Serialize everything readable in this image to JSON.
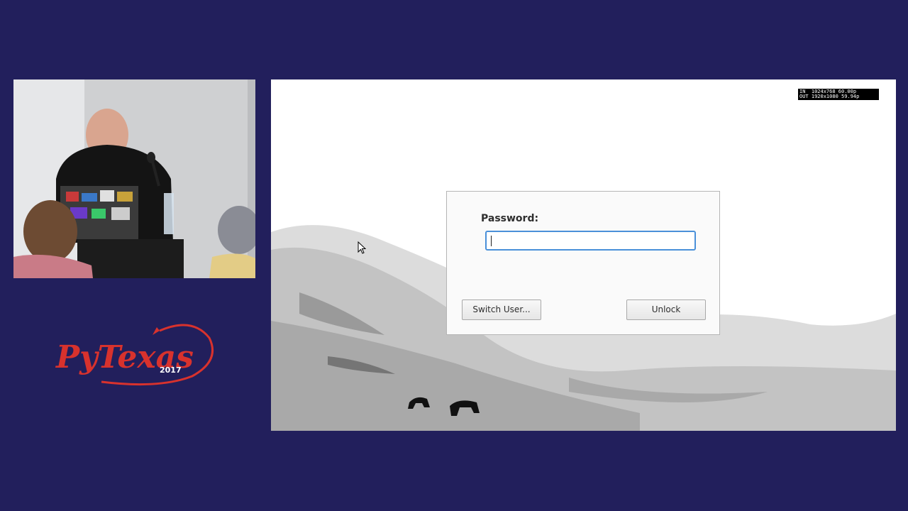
{
  "screen": {
    "signal_info_in": "IN  1024x768 60.00p",
    "signal_info_out": "OUT 1920x1080 59.94p"
  },
  "lock_dialog": {
    "password_label": "Password:",
    "password_value": "",
    "switch_user_label": "Switch User...",
    "unlock_label": "Unlock"
  },
  "logo": {
    "name": "PyTexas",
    "year": "2017",
    "color": "#d8322d"
  },
  "colors": {
    "background": "#221f5c",
    "focus_border": "#4a90d9"
  }
}
